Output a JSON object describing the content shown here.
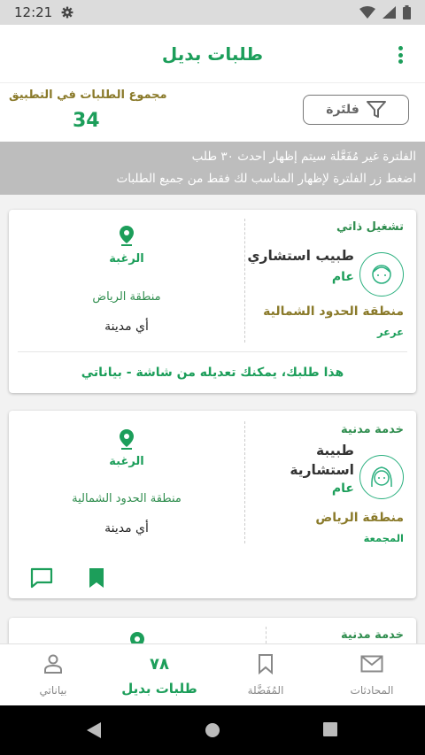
{
  "status": {
    "time": "12:21"
  },
  "header": {
    "title": "طلبات بديل"
  },
  "summary": {
    "total_label": "مجموع الطلبات في التطبيق",
    "total_value": "34",
    "filter_label": "فلتَرة"
  },
  "banner": {
    "line1": "الفلترة غير مُفَعَّلة سيتم إظهار احدث ٣٠ طلب",
    "line2": "اضغط زر الفلترة لإظهار المناسب لك فقط من جميع الطلبات"
  },
  "cards": [
    {
      "service": "تشغيل ذاتي",
      "job": "طبيب استشاري",
      "level": "عام",
      "region": "منطقة الحدود الشمالية",
      "city": "عرعر",
      "pref_title": "الرغبة",
      "pref_region": "منطقة الرياض",
      "pref_city": "أي مدينة",
      "note": "هذا طلبك، يمكنك تعديله من شاشة - بياناتي"
    },
    {
      "service": "خدمة مدنية",
      "job_line1": "طبيبة",
      "job_line2": "استشارية",
      "level": "عام",
      "region": "منطقة الرياض",
      "city": "المجمعة",
      "pref_title": "الرغبة",
      "pref_region": "منطقة الحدود الشمالية",
      "pref_city": "أي مدينة"
    },
    {
      "service": "خدمة مدنية"
    }
  ],
  "nav": {
    "conversations": "المحادثات",
    "favorites": "المُفَضَّلة",
    "requests": "طلبات بديل",
    "mydata": "بياناتي",
    "requests_icon": "٧٨"
  },
  "colors": {
    "accent": "#1c9e5a",
    "gold": "#8a7a2a",
    "banner": "#bdbdbd"
  }
}
